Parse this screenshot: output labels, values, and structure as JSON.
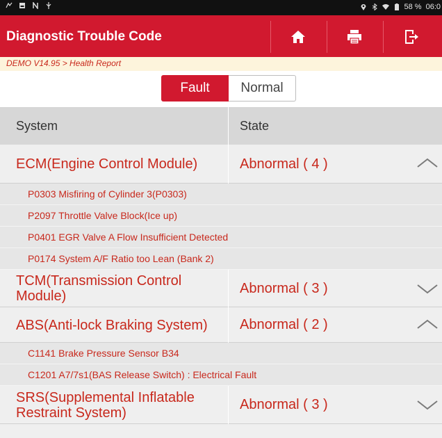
{
  "status_bar": {
    "battery": "58 %",
    "time": "06:0"
  },
  "header": {
    "title": "Diagnostic Trouble Code",
    "buttons": [
      {
        "icon": "home-icon"
      },
      {
        "icon": "printer-icon"
      },
      {
        "icon": "exit-icon"
      }
    ]
  },
  "breadcrumb": "DEMO V14.95 > Health Report",
  "filter": {
    "options": [
      "Fault",
      "Normal"
    ],
    "selected": "Fault"
  },
  "table": {
    "columns": [
      "System",
      "State"
    ],
    "rows": [
      {
        "system": "ECM(Engine Control Module)",
        "state": "Abnormal ( 4 )",
        "expanded": true,
        "codes": [
          "P0303 Misfiring of Cylinder 3(P0303)",
          "P2097 Throttle Valve Block(Ice up)",
          "P0401 EGR Valve A Flow Insufficient Detected",
          "P0174 System A/F Ratio too Lean (Bank 2)"
        ]
      },
      {
        "system": "TCM(Transmission Control Module)",
        "state": "Abnormal ( 3 )",
        "expanded": false,
        "codes": []
      },
      {
        "system": "ABS(Anti-lock Braking System)",
        "state": "Abnormal ( 2 )",
        "expanded": true,
        "codes": [
          "C1141 Brake Pressure Sensor B34",
          "C1201 A7/7s1(BAS Release Switch) : Electrical Fault"
        ]
      },
      {
        "system": "SRS(Supplemental Inflatable Restraint System)",
        "state": "Abnormal ( 3 )",
        "expanded": false,
        "codes": []
      }
    ]
  },
  "colors": {
    "primary": "#d1192f",
    "text_red": "#c8281c",
    "breadcrumb_bg": "#fdf4dc",
    "row_bg": "#efefef",
    "code_bg": "#e6e6e6",
    "header_bg": "#d7d7d7"
  }
}
